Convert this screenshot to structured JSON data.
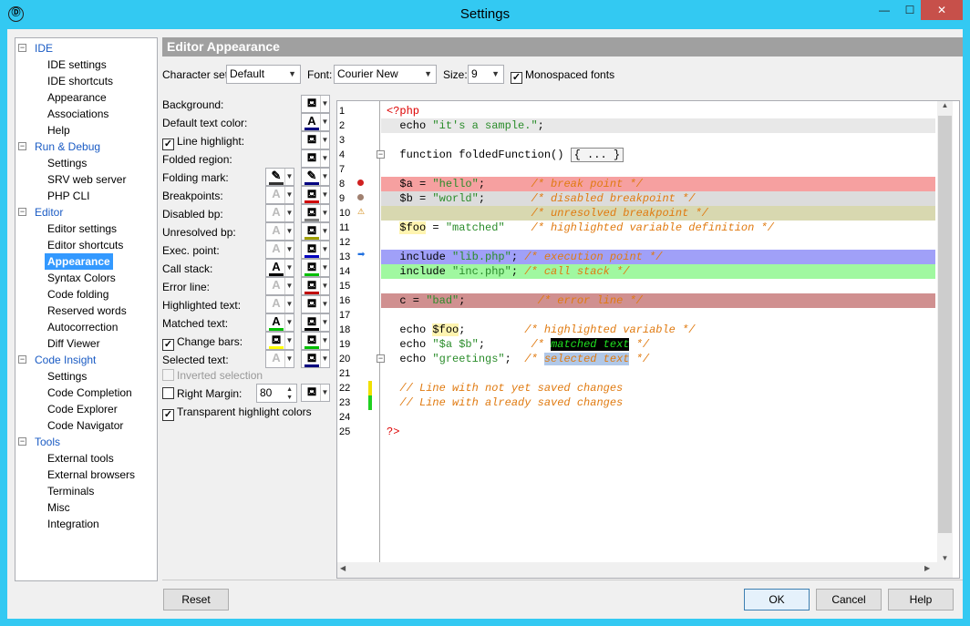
{
  "window": {
    "title": "Settings",
    "min_label": "—",
    "max_label": "☐",
    "close_label": "✕",
    "app_icon_glyph": "Ⓓ"
  },
  "tree": [
    {
      "type": "cat",
      "label": "IDE"
    },
    {
      "type": "item",
      "label": "IDE settings"
    },
    {
      "type": "item",
      "label": "IDE shortcuts"
    },
    {
      "type": "item",
      "label": "Appearance"
    },
    {
      "type": "item",
      "label": "Associations"
    },
    {
      "type": "item",
      "label": "Help"
    },
    {
      "type": "cat",
      "label": "Run & Debug"
    },
    {
      "type": "item",
      "label": "Settings"
    },
    {
      "type": "item",
      "label": "SRV web server"
    },
    {
      "type": "item",
      "label": "PHP CLI"
    },
    {
      "type": "cat",
      "label": "Editor"
    },
    {
      "type": "item",
      "label": "Editor settings"
    },
    {
      "type": "item",
      "label": "Editor shortcuts"
    },
    {
      "type": "item",
      "label": "Appearance",
      "selected": true
    },
    {
      "type": "item",
      "label": "Syntax Colors"
    },
    {
      "type": "item",
      "label": "Code folding"
    },
    {
      "type": "item",
      "label": "Reserved words"
    },
    {
      "type": "item",
      "label": "Autocorrection"
    },
    {
      "type": "item",
      "label": "Diff Viewer"
    },
    {
      "type": "cat",
      "label": "Code Insight"
    },
    {
      "type": "item",
      "label": "Settings"
    },
    {
      "type": "item",
      "label": "Code Completion"
    },
    {
      "type": "item",
      "label": "Code Explorer"
    },
    {
      "type": "item",
      "label": "Code Navigator"
    },
    {
      "type": "cat",
      "label": "Tools"
    },
    {
      "type": "item",
      "label": "External tools"
    },
    {
      "type": "item",
      "label": "External browsers"
    },
    {
      "type": "item",
      "label": "Terminals"
    },
    {
      "type": "item",
      "label": "Misc"
    },
    {
      "type": "item",
      "label": "Integration"
    }
  ],
  "panel": {
    "header": "Editor Appearance",
    "charset_label": "Character set:",
    "charset_value": "Default",
    "font_label": "Font:",
    "font_value": "Courier New",
    "size_label": "Size:",
    "size_value": "9",
    "monospaced_label": "Monospaced fonts",
    "monospaced_checked": true
  },
  "settings": [
    {
      "label": "Background:",
      "check": null,
      "fg": null,
      "bg": "#ffffff"
    },
    {
      "label": "Default text color:",
      "check": null,
      "fg": null,
      "bg": "#000080",
      "bgtype": "A"
    },
    {
      "label": "Line highlight:",
      "check": true,
      "fg": null,
      "bg": "#ffffff"
    },
    {
      "label": "Folded region:",
      "check": null,
      "fg": null,
      "bg": "#ffffff"
    },
    {
      "label": "Folding mark:",
      "check": null,
      "fg": "#333333",
      "fgtype": "pen",
      "bg": "#000080",
      "bgtype": "pen"
    },
    {
      "label": "Breakpoints:",
      "check": null,
      "fg": "dis",
      "bg": "#d00000"
    },
    {
      "label": "Disabled bp:",
      "check": null,
      "fg": "dis",
      "bg": "#808080"
    },
    {
      "label": "Unresolved bp:",
      "check": null,
      "fg": "dis",
      "bg": "#a0a000"
    },
    {
      "label": "Exec. point:",
      "check": null,
      "fg": "dis",
      "bg": "#0000c0"
    },
    {
      "label": "Call stack:",
      "check": null,
      "fg": "#000000",
      "bg": "#00c000"
    },
    {
      "label": "Error line:",
      "check": null,
      "fg": "dis",
      "bg": "#c00000"
    },
    {
      "label": "Highlighted text:",
      "check": null,
      "fg": "dis",
      "bg": "#ffffff"
    },
    {
      "label": "Matched text:",
      "check": null,
      "fg": "#00c000",
      "bg": "#000000"
    },
    {
      "label": "Change bars:",
      "check": true,
      "fg": "#ffff00",
      "fgtype": "paint",
      "bg": "#00c000"
    },
    {
      "label": "Selected text:",
      "check": null,
      "fg": "dis",
      "bg": "#000080"
    }
  ],
  "inverted_selection_label": "Inverted selection",
  "right_margin_label": "Right Margin:",
  "right_margin_value": "80",
  "transparent_label": "Transparent highlight colors",
  "code_lines": [
    {
      "n": "1",
      "segs": [
        {
          "t": "<?php",
          "c": "php"
        }
      ]
    },
    {
      "n": "2",
      "bg": "#e8e8e8",
      "segs": [
        {
          "t": "  echo ",
          "c": "kw"
        },
        {
          "t": "\"it's a sample.\"",
          "c": "str"
        },
        {
          "t": ";",
          "c": "kw"
        }
      ]
    },
    {
      "n": "3",
      "segs": []
    },
    {
      "n": "4",
      "fold": true,
      "segs": [
        {
          "t": "  function foldedFunction() ",
          "c": "kw"
        },
        {
          "t": "{ ... }",
          "c": "box"
        }
      ]
    },
    {
      "n": "7",
      "segs": []
    },
    {
      "n": "8",
      "mark": "bp",
      "bg": "#f6a0a0",
      "segs": [
        {
          "t": "  $a = ",
          "c": "kw"
        },
        {
          "t": "\"hello\"",
          "c": "str"
        },
        {
          "t": ";       ",
          "c": "kw"
        },
        {
          "t": "/* break point */",
          "c": "cmt"
        }
      ]
    },
    {
      "n": "9",
      "mark": "dbp",
      "bg": "#dcdcdc",
      "segs": [
        {
          "t": "  $b = ",
          "c": "kw"
        },
        {
          "t": "\"world\"",
          "c": "str"
        },
        {
          "t": ";       ",
          "c": "kw"
        },
        {
          "t": "/* disabled breakpoint */",
          "c": "cmt"
        }
      ]
    },
    {
      "n": "10",
      "mark": "ubp",
      "bg": "#d8d8b0",
      "segs": [
        {
          "t": "                      ",
          "c": "kw"
        },
        {
          "t": "/* unresolved breakpoint */",
          "c": "cmt"
        }
      ]
    },
    {
      "n": "11",
      "segs": [
        {
          "t": "  ",
          "c": "kw"
        },
        {
          "t": "$foo",
          "c": "hl"
        },
        {
          "t": " = ",
          "c": "kw"
        },
        {
          "t": "\"matched\"",
          "c": "str"
        },
        {
          "t": "    ",
          "c": "kw"
        },
        {
          "t": "/* highlighted variable definition */",
          "c": "cmt"
        }
      ]
    },
    {
      "n": "12",
      "segs": []
    },
    {
      "n": "13",
      "mark": "exec",
      "bg": "#a0a0f8",
      "segs": [
        {
          "t": "  include ",
          "c": "kw"
        },
        {
          "t": "\"lib.php\"",
          "c": "str"
        },
        {
          "t": "; ",
          "c": "kw"
        },
        {
          "t": "/* execution point */",
          "c": "cmt"
        }
      ]
    },
    {
      "n": "14",
      "bg": "#a0f8a0",
      "segs": [
        {
          "t": "  include ",
          "c": "kw"
        },
        {
          "t": "\"inc.php\"",
          "c": "str"
        },
        {
          "t": "; ",
          "c": "kw"
        },
        {
          "t": "/* call stack */",
          "c": "cmt"
        }
      ]
    },
    {
      "n": "15",
      "segs": []
    },
    {
      "n": "16",
      "bg": "#d09090",
      "segs": [
        {
          "t": "  c = ",
          "c": "kw"
        },
        {
          "t": "\"bad\"",
          "c": "str"
        },
        {
          "t": ";           ",
          "c": "kw"
        },
        {
          "t": "/* error line */",
          "c": "cmt"
        }
      ]
    },
    {
      "n": "17",
      "segs": []
    },
    {
      "n": "18",
      "segs": [
        {
          "t": "  echo ",
          "c": "kw"
        },
        {
          "t": "$foo",
          "c": "hl"
        },
        {
          "t": ";         ",
          "c": "kw"
        },
        {
          "t": "/* highlighted variable */",
          "c": "cmt"
        }
      ]
    },
    {
      "n": "19",
      "segs": [
        {
          "t": "  echo ",
          "c": "kw"
        },
        {
          "t": "\"$a $b\"",
          "c": "str"
        },
        {
          "t": ";       ",
          "c": "kw"
        },
        {
          "t": "/* ",
          "c": "cmt"
        },
        {
          "t": "matched text",
          "c": "match"
        },
        {
          "t": " */",
          "c": "cmt"
        }
      ]
    },
    {
      "n": "20",
      "fold": true,
      "segs": [
        {
          "t": "  echo ",
          "c": "kw"
        },
        {
          "t": "\"greetings\"",
          "c": "str"
        },
        {
          "t": ";  ",
          "c": "kw"
        },
        {
          "t": "/* ",
          "c": "cmt"
        },
        {
          "t": "selected text",
          "c": "sel"
        },
        {
          "t": " */",
          "c": "cmt"
        }
      ]
    },
    {
      "n": "21",
      "segs": []
    },
    {
      "n": "22",
      "change": "#f0e000",
      "segs": [
        {
          "t": "  ",
          "c": "kw"
        },
        {
          "t": "// Line with not yet saved changes",
          "c": "cmt"
        }
      ]
    },
    {
      "n": "23",
      "change": "#20d020",
      "segs": [
        {
          "t": "  ",
          "c": "kw"
        },
        {
          "t": "// Line with already saved changes",
          "c": "cmt"
        }
      ]
    },
    {
      "n": "24",
      "segs": []
    },
    {
      "n": "25",
      "segs": [
        {
          "t": "?>",
          "c": "php"
        }
      ]
    }
  ],
  "buttons": {
    "reset": "Reset",
    "ok": "OK",
    "cancel": "Cancel",
    "help": "Help"
  }
}
